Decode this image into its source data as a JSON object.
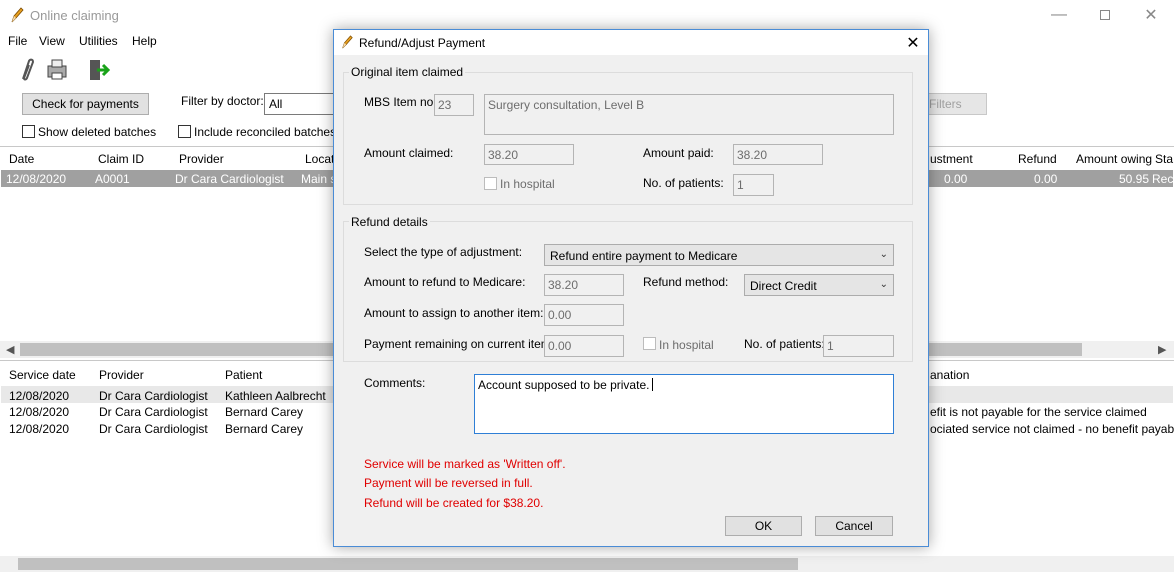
{
  "app": {
    "title": "Online claiming",
    "menu": [
      "File",
      "View",
      "Utilities",
      "Help"
    ]
  },
  "toolbar_main": {
    "check_payments": "Check for payments",
    "filter_doctor_label": "Filter by doctor:",
    "filter_doctor_value": "All",
    "clear_filters": "Filters",
    "show_deleted": "Show deleted batches",
    "include_reconciled": "Include reconciled batches"
  },
  "batch_grid": {
    "headers": [
      "Date",
      "Claim ID",
      "Provider",
      "Locati",
      "ustment",
      "Refund",
      "Amount owing",
      "Sta"
    ],
    "rows": [
      {
        "date": "12/08/2020",
        "claim_id": "A0001",
        "provider": "Dr Cara Cardiologist",
        "location": "Main s",
        "adjustment": "0.00",
        "refund": "0.00",
        "owing": "50.95",
        "status": "Rec"
      }
    ]
  },
  "service_grid": {
    "headers": [
      "Service date",
      "Provider",
      "Patient",
      "anation"
    ],
    "rows": [
      {
        "date": "12/08/2020",
        "provider": "Dr Cara Cardiologist",
        "patient": "Kathleen Aalbrecht",
        "explanation": ""
      },
      {
        "date": "12/08/2020",
        "provider": "Dr Cara Cardiologist",
        "patient": "Bernard Carey",
        "explanation": "efit is not payable for the service claimed"
      },
      {
        "date": "12/08/2020",
        "provider": "Dr Cara Cardiologist",
        "patient": "Bernard Carey",
        "explanation": "ociated service not claimed - no benefit payable"
      }
    ]
  },
  "dialog": {
    "title": "Refund/Adjust Payment",
    "original": {
      "group_title": "Original item claimed",
      "mbs_label": "MBS Item no:",
      "mbs_value": "23",
      "description": "Surgery consultation, Level B",
      "amount_claimed_label": "Amount claimed:",
      "amount_claimed": "38.20",
      "amount_paid_label": "Amount paid:",
      "amount_paid": "38.20",
      "in_hospital": "In hospital",
      "patients_label": "No. of patients:",
      "patients": "1"
    },
    "refund": {
      "group_title": "Refund details",
      "type_label": "Select the type of adjustment:",
      "type_value": "Refund entire payment to Medicare",
      "refund_medicare_label": "Amount to refund to Medicare:",
      "refund_medicare": "38.20",
      "method_label": "Refund method:",
      "method_value": "Direct Credit",
      "assign_label": "Amount to assign to another item:",
      "assign_value": "0.00",
      "remaining_label": "Payment remaining on current item:",
      "remaining_value": "0.00",
      "in_hospital": "In hospital",
      "patients_label": "No. of patients:",
      "patients": "1"
    },
    "comments_label": "Comments:",
    "comments_value": "Account supposed to be private.",
    "messages": [
      "Service will be marked as 'Written off'.",
      "Payment will be reversed in full.",
      "Refund will be created for $38.20."
    ],
    "ok": "OK",
    "cancel": "Cancel"
  },
  "colors": {
    "accent": "#2f7fd6",
    "warning": "#e00000",
    "selected_row": "#a0a0a0"
  }
}
